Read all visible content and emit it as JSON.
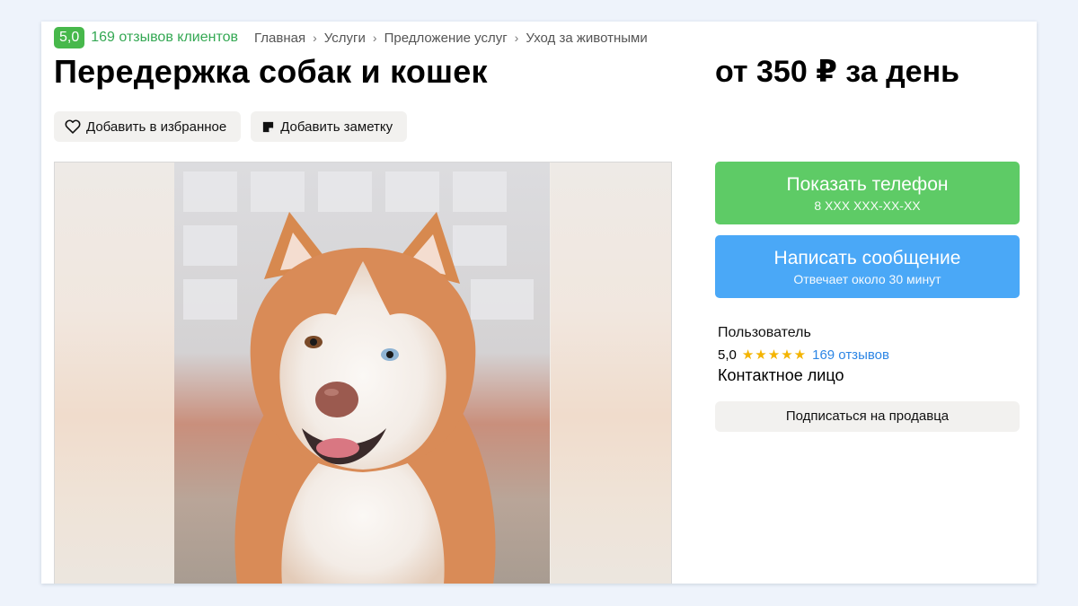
{
  "header": {
    "rating_value": "5,0",
    "reviews_link": "169 отзывов клиентов",
    "breadcrumbs": [
      "Главная",
      "Услуги",
      "Предложение услуг",
      "Уход за животными"
    ]
  },
  "listing": {
    "title": "Передержка собак и кошек",
    "price": "от 350 ₽ за день"
  },
  "actions": {
    "favorite_label": "Добавить в избранное",
    "note_label": "Добавить заметку"
  },
  "contact": {
    "phone_button": "Показать телефон",
    "phone_masked": "8 XXX XXX-XX-XX",
    "message_button": "Написать сообщение",
    "message_sub": "Отвечает около 30 минут"
  },
  "seller": {
    "type": "Пользователь",
    "rating": "5,0",
    "stars": "★★★★★",
    "reviews": "169 отзывов",
    "name": "Контактное лицо",
    "subscribe_button": "Подписаться на продавца"
  },
  "colors": {
    "rating_badge": "#47b84b",
    "phone_button": "#5ecb66",
    "message_button": "#4aa8f7",
    "link": "#2d86e5",
    "stars": "#f4b400"
  },
  "icons": {
    "favorite": "heart-icon",
    "note": "note-icon",
    "breadcrumb_separator": "chevron-right-icon"
  }
}
